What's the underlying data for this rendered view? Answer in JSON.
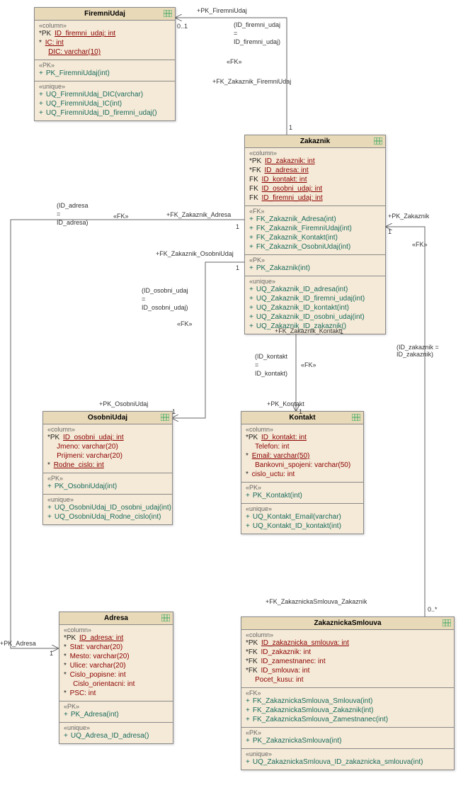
{
  "classes": {
    "FiremniUdaj": {
      "title": "FiremniUdaj",
      "columns_label": "«column»",
      "cols": [
        {
          "prefix": "*PK",
          "text": "ID_firemni_udaj: int",
          "u": true
        },
        {
          "prefix": "*",
          "text": "IC: int",
          "u": true
        },
        {
          "prefix": "",
          "text": "DIC: varchar(10)",
          "u": true
        }
      ],
      "pk_label": "«PK»",
      "pk_ops": [
        "PK_FiremniUdaj(int)"
      ],
      "uq_label": "«unique»",
      "uq_ops": [
        "UQ_FiremniUdaj_DIC(varchar)",
        "UQ_FiremniUdaj_IC(int)",
        "UQ_FiremniUdaj_ID_firemni_udaj()"
      ]
    },
    "Zakaznik": {
      "title": "Zakaznik",
      "columns_label": "«column»",
      "cols": [
        {
          "prefix": "*PK",
          "text": "ID_zakaznik: int",
          "u": true
        },
        {
          "prefix": "*FK",
          "text": "ID_adresa: int",
          "u": true
        },
        {
          "prefix": " FK",
          "text": "ID_kontakt: int",
          "u": true
        },
        {
          "prefix": " FK",
          "text": "ID_osobni_udaj: int",
          "u": true
        },
        {
          "prefix": " FK",
          "text": "ID_firemni_udaj: int",
          "u": true
        }
      ],
      "fk_label": "«FK»",
      "fk_ops": [
        "FK_Zakaznik_Adresa(int)",
        "FK_Zakaznik_FiremniUdaj(int)",
        "FK_Zakaznik_Kontakt(int)",
        "FK_Zakaznik_OsobniUdaj(int)"
      ],
      "pk_label": "«PK»",
      "pk_ops": [
        "PK_Zakaznik(int)"
      ],
      "uq_label": "«unique»",
      "uq_ops": [
        "UQ_Zakaznik_ID_adresa(int)",
        "UQ_Zakaznik_ID_firemni_udaj(int)",
        "UQ_Zakaznik_ID_kontakt(int)",
        "UQ_Zakaznik_ID_osobni_udaj(int)",
        "UQ_Zakaznik_ID_zakaznik()"
      ]
    },
    "OsobniUdaj": {
      "title": "OsobniUdaj",
      "columns_label": "«column»",
      "cols": [
        {
          "prefix": "*PK",
          "text": "ID_osobni_udaj: int",
          "u": true
        },
        {
          "prefix": "",
          "text": "Jmeno: varchar(20)",
          "u": false
        },
        {
          "prefix": "",
          "text": "Prijmeni: varchar(20)",
          "u": false
        },
        {
          "prefix": "*",
          "text": "Rodne_cislo: int",
          "u": true
        }
      ],
      "pk_label": "«PK»",
      "pk_ops": [
        "PK_OsobniUdaj(int)"
      ],
      "uq_label": "«unique»",
      "uq_ops": [
        "UQ_OsobniUdaj_ID_osobni_udaj(int)",
        "UQ_OsobniUdaj_Rodne_cislo(int)"
      ]
    },
    "Kontakt": {
      "title": "Kontakt",
      "columns_label": "«column»",
      "cols": [
        {
          "prefix": "*PK",
          "text": "ID_kontakt: int",
          "u": true
        },
        {
          "prefix": "",
          "text": "Telefon: int",
          "u": false
        },
        {
          "prefix": "*",
          "text": "Email: varchar(50)",
          "u": true
        },
        {
          "prefix": "",
          "text": "Bankovni_spojeni: varchar(50)",
          "u": false
        },
        {
          "prefix": "*",
          "text": "cislo_uctu: int",
          "u": false
        }
      ],
      "pk_label": "«PK»",
      "pk_ops": [
        "PK_Kontakt(int)"
      ],
      "uq_label": "«unique»",
      "uq_ops": [
        "UQ_Kontakt_Email(varchar)",
        "UQ_Kontakt_ID_kontakt(int)"
      ]
    },
    "Adresa": {
      "title": "Adresa",
      "columns_label": "«column»",
      "cols": [
        {
          "prefix": "*PK",
          "text": "ID_adresa: int",
          "u": true
        },
        {
          "prefix": "*",
          "text": "Stat: varchar(20)",
          "u": false
        },
        {
          "prefix": "*",
          "text": "Mesto: varchar(20)",
          "u": false
        },
        {
          "prefix": "*",
          "text": "Ulice: varchar(20)",
          "u": false
        },
        {
          "prefix": "*",
          "text": "Cislo_popisne: int",
          "u": false
        },
        {
          "prefix": "",
          "text": "Cislo_orientacni: int",
          "u": false
        },
        {
          "prefix": "*",
          "text": "PSC: int",
          "u": false
        }
      ],
      "pk_label": "«PK»",
      "pk_ops": [
        "PK_Adresa(int)"
      ],
      "uq_label": "«unique»",
      "uq_ops": [
        "UQ_Adresa_ID_adresa()"
      ]
    },
    "ZakaznickaSmlouva": {
      "title": "ZakaznickaSmlouva",
      "columns_label": "«column»",
      "cols": [
        {
          "prefix": "*PK",
          "text": "ID_zakaznicka_smlouva: int",
          "u": true
        },
        {
          "prefix": "*FK",
          "text": "ID_zakaznik: int",
          "u": false
        },
        {
          "prefix": "*FK",
          "text": "ID_zamestnanec: int",
          "u": false
        },
        {
          "prefix": "*FK",
          "text": "ID_smlouva: int",
          "u": false
        },
        {
          "prefix": "",
          "text": "Pocet_kusu: int",
          "u": false
        }
      ],
      "fk_label": "«FK»",
      "fk_ops": [
        "FK_ZakaznickaSmlouva_Smlouva(int)",
        "FK_ZakaznickaSmlouva_Zakaznik(int)",
        "FK_ZakaznickaSmlouva_Zamestnanec(int)"
      ],
      "pk_label": "«PK»",
      "pk_ops": [
        "PK_ZakaznickaSmlouva(int)"
      ],
      "uq_label": "«unique»",
      "uq_ops": [
        "UQ_ZakaznickaSmlouva_ID_zakaznicka_smlouva(int)"
      ]
    }
  },
  "labels": {
    "pk_firemni": "+PK_FiremniUdaj",
    "mult_01": "0..1",
    "firemni_eq1": "(ID_firemni_udaj",
    "firemni_eq2": "=",
    "firemni_eq3": "ID_firemni_udaj)",
    "fk_ster": "«FK»",
    "fk_zak_firemni": "+FK_Zakaznik_FiremniUdaj",
    "mult_1": "1",
    "fk_zak_adresa": "+FK_Zakaznik_Adresa",
    "adresa_eq1": "(ID_adresa",
    "adresa_eq2": "=",
    "adresa_eq3": "ID_adresa)",
    "fk_zak_osobni": "+FK_Zakaznik_OsobniUdaj",
    "osobni_eq1": "(ID_osobni_udaj",
    "osobni_eq2": "=",
    "osobni_eq3": "ID_osobni_udaj)",
    "pk_osobni": "+PK_OsobniUdaj",
    "fk_zak_kontakt": "+FK_Zakaznik_Kontakt",
    "kontakt_eq1": "(ID_kontakt",
    "kontakt_eq2": "=",
    "kontakt_eq3": "ID_kontakt)",
    "pk_kontakt": "+PK_Kontakt",
    "pk_zakaznik": "+PK_Zakaznik",
    "zak_eq": "(ID_zakaznik =\nID_zakaznik)",
    "fk_zs_zak": "+FK_ZakaznickaSmlouva_Zakaznik",
    "mult_0s": "0..*",
    "pk_adresa": "+PK_Adresa"
  }
}
